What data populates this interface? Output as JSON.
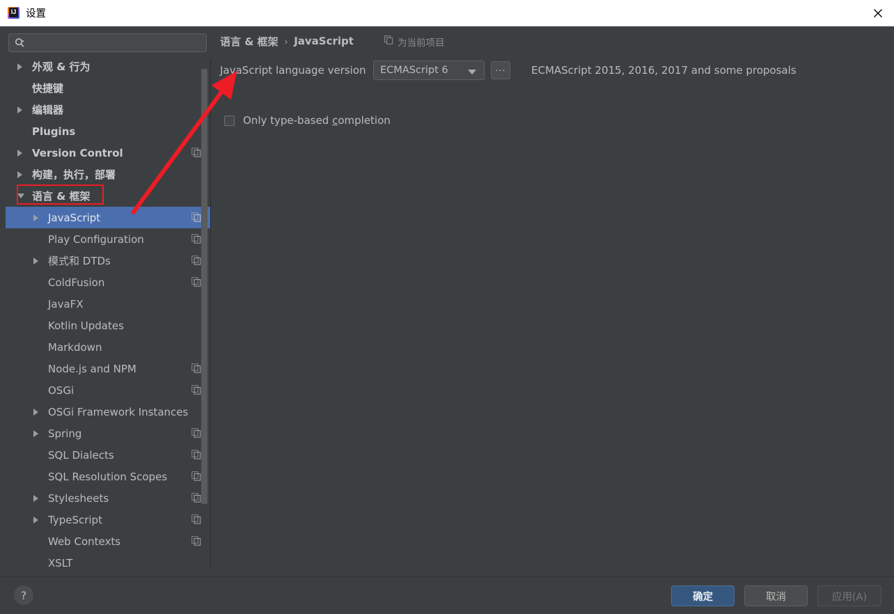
{
  "window": {
    "title": "设置",
    "app_icon": "intellij-idea-icon",
    "close_icon": "close-icon"
  },
  "search": {
    "value": "",
    "placeholder": "",
    "icon": "search-icon"
  },
  "sidebar": {
    "scrollbar": "vertical-scrollbar",
    "items": [
      {
        "label": "外观 & 行为",
        "level": 0,
        "twisty": "collapsed",
        "bold": true,
        "copy": false,
        "selected": false
      },
      {
        "label": "快捷键",
        "level": 0,
        "twisty": "none",
        "bold": true,
        "copy": false,
        "selected": false
      },
      {
        "label": "编辑器",
        "level": 0,
        "twisty": "collapsed",
        "bold": true,
        "copy": false,
        "selected": false
      },
      {
        "label": "Plugins",
        "level": 0,
        "twisty": "none",
        "bold": true,
        "copy": false,
        "selected": false
      },
      {
        "label": "Version Control",
        "level": 0,
        "twisty": "collapsed",
        "bold": true,
        "copy": true,
        "selected": false
      },
      {
        "label": "构建，执行，部署",
        "level": 0,
        "twisty": "collapsed",
        "bold": true,
        "copy": false,
        "selected": false
      },
      {
        "label": "语言 & 框架",
        "level": 0,
        "twisty": "expanded",
        "bold": true,
        "copy": false,
        "selected": false,
        "highlight": true
      },
      {
        "label": "JavaScript",
        "level": 1,
        "twisty": "collapsed",
        "bold": false,
        "copy": true,
        "selected": true
      },
      {
        "label": "Play Configuration",
        "level": 1,
        "twisty": "none",
        "bold": false,
        "copy": true,
        "selected": false
      },
      {
        "label": "模式和 DTDs",
        "level": 1,
        "twisty": "collapsed",
        "bold": false,
        "copy": true,
        "selected": false
      },
      {
        "label": "ColdFusion",
        "level": 1,
        "twisty": "none",
        "bold": false,
        "copy": true,
        "selected": false
      },
      {
        "label": "JavaFX",
        "level": 1,
        "twisty": "none",
        "bold": false,
        "copy": false,
        "selected": false
      },
      {
        "label": "Kotlin Updates",
        "level": 1,
        "twisty": "none",
        "bold": false,
        "copy": false,
        "selected": false
      },
      {
        "label": "Markdown",
        "level": 1,
        "twisty": "none",
        "bold": false,
        "copy": false,
        "selected": false
      },
      {
        "label": "Node.js and NPM",
        "level": 1,
        "twisty": "none",
        "bold": false,
        "copy": true,
        "selected": false
      },
      {
        "label": "OSGi",
        "level": 1,
        "twisty": "none",
        "bold": false,
        "copy": true,
        "selected": false
      },
      {
        "label": "OSGi Framework Instances",
        "level": 1,
        "twisty": "collapsed",
        "bold": false,
        "copy": false,
        "selected": false
      },
      {
        "label": "Spring",
        "level": 1,
        "twisty": "collapsed",
        "bold": false,
        "copy": true,
        "selected": false
      },
      {
        "label": "SQL Dialects",
        "level": 1,
        "twisty": "none",
        "bold": false,
        "copy": true,
        "selected": false
      },
      {
        "label": "SQL Resolution Scopes",
        "level": 1,
        "twisty": "none",
        "bold": false,
        "copy": true,
        "selected": false
      },
      {
        "label": "Stylesheets",
        "level": 1,
        "twisty": "collapsed",
        "bold": false,
        "copy": true,
        "selected": false
      },
      {
        "label": "TypeScript",
        "level": 1,
        "twisty": "collapsed",
        "bold": false,
        "copy": true,
        "selected": false
      },
      {
        "label": "Web Contexts",
        "level": 1,
        "twisty": "none",
        "bold": false,
        "copy": true,
        "selected": false
      },
      {
        "label": "XSLT",
        "level": 1,
        "twisty": "none",
        "bold": false,
        "copy": false,
        "selected": false
      }
    ]
  },
  "main": {
    "breadcrumb": {
      "parent": "语言 & 框架",
      "separator": "›",
      "current": "JavaScript"
    },
    "project_scope": {
      "icon": "copy-scope-icon",
      "label": "为当前项目"
    },
    "language_version": {
      "label": "JavaScript language version",
      "selected": "ECMAScript 6",
      "dropdown_icon": "chevron-down-icon",
      "ellipsis_button": "...",
      "description": "ECMAScript 2015, 2016, 2017 and some proposals"
    },
    "only_type_based": {
      "label_before": "Only type-based ",
      "label_mnemonic": "c",
      "label_after": "ompletion",
      "checked": false
    }
  },
  "footer": {
    "help_label": "?",
    "ok_label": "确定",
    "cancel_label": "取消",
    "apply_label": "应用(A)"
  },
  "annotations": {
    "arrow_color": "#ee1c25",
    "highlight_box_color": "#ee1c25"
  },
  "colors": {
    "background": "#3c3f41",
    "selection": "#4b6eaf",
    "text": "#bbbbbb",
    "titlebar": "#ffffff",
    "ok_button": "#365880"
  }
}
